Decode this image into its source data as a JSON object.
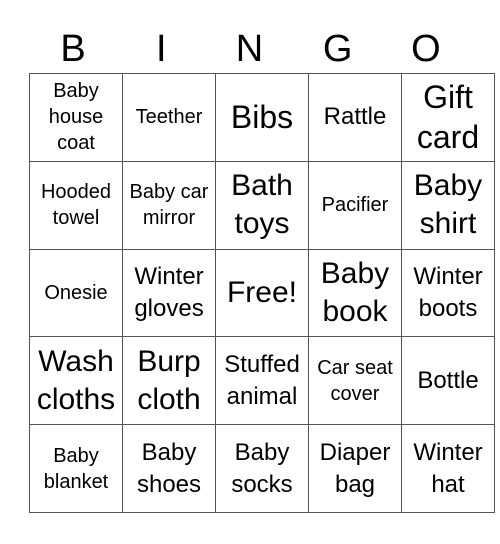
{
  "header": {
    "letters": [
      "B",
      "I",
      "N",
      "G",
      "O"
    ]
  },
  "card": {
    "rows": [
      [
        "Baby house coat",
        "Teether",
        "Bibs",
        "Rattle",
        "Gift card"
      ],
      [
        "Hooded towel",
        "Baby car mirror",
        "Bath toys",
        "Pacifier",
        "Baby shirt"
      ],
      [
        "Onesie",
        "Winter gloves",
        "Free!",
        "Baby book",
        "Winter boots"
      ],
      [
        "Wash cloths",
        "Burp cloth",
        "Stuffed animal",
        "Car seat cover",
        "Bottle"
      ],
      [
        "Baby blanket",
        "Baby shoes",
        "Baby socks",
        "Diaper bag",
        "Winter hat"
      ]
    ]
  }
}
